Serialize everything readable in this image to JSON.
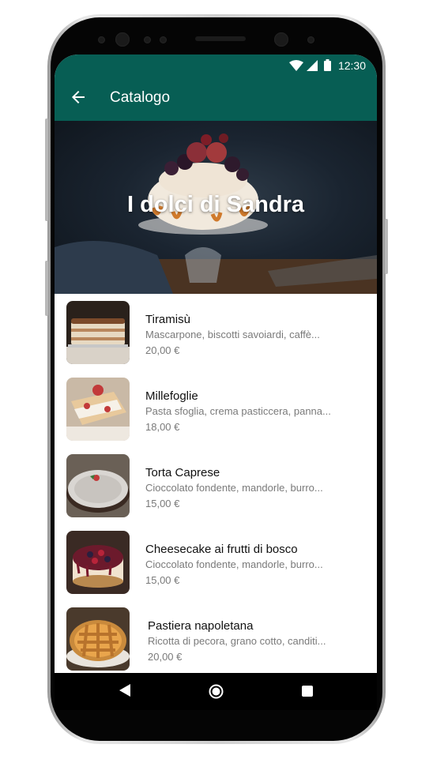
{
  "status_bar": {
    "time": "12:30",
    "icons": [
      "wifi-icon",
      "signal-icon",
      "battery-icon"
    ]
  },
  "app_bar": {
    "title": "Catalogo",
    "back_icon": "arrow-back-icon",
    "color": "#075e54"
  },
  "hero": {
    "title": "I dolci di Sandra"
  },
  "products": [
    {
      "name": "Tiramisù",
      "description": "Mascarpone, biscotti savoiardi, caffè...",
      "price": "20,00 €"
    },
    {
      "name": "Millefoglie",
      "description": "Pasta sfoglia, crema pasticcera, panna...",
      "price": "18,00 €"
    },
    {
      "name": "Torta Caprese",
      "description": "Cioccolato fondente, mandorle, burro...",
      "price": "15,00 €"
    },
    {
      "name": "Cheesecake ai frutti di bosco",
      "description": "Cioccolato fondente, mandorle, burro...",
      "price": "15,00 €"
    },
    {
      "name": "Pastiera napoletana",
      "description": "Ricotta di pecora, grano cotto, canditi...",
      "price": "20,00 €"
    }
  ],
  "nav_bar": {
    "buttons": [
      "back-triangle-icon",
      "home-circle-icon",
      "recents-square-icon"
    ]
  }
}
